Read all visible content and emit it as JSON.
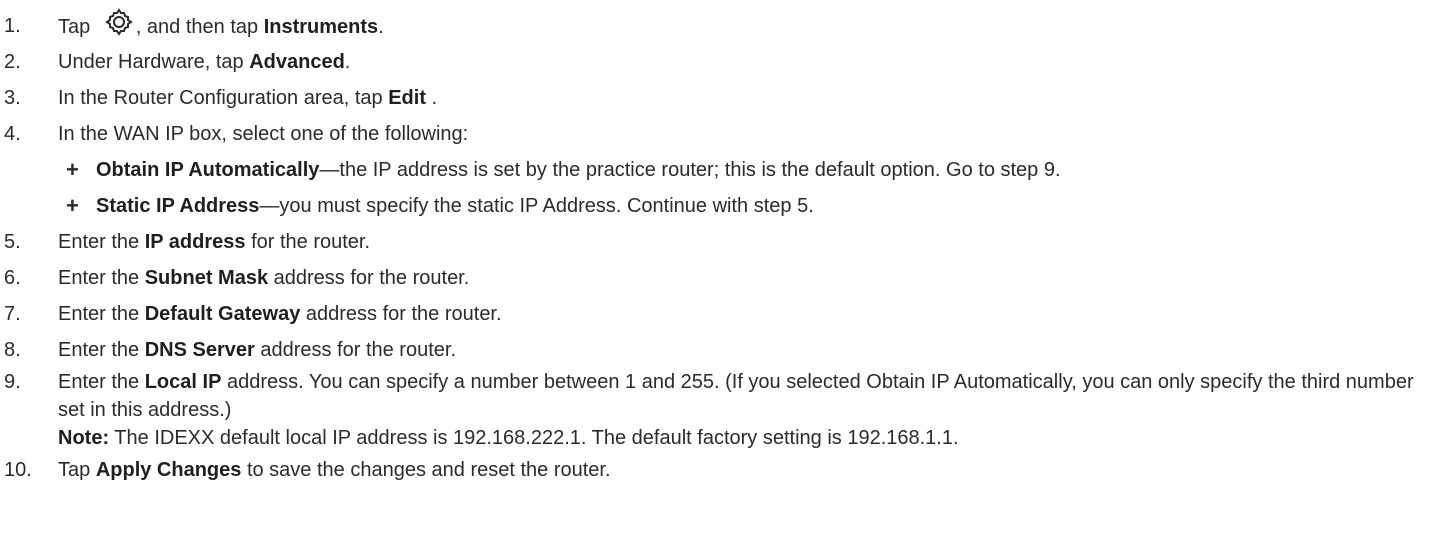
{
  "steps": [
    {
      "num": "1.",
      "pre": "Tap ",
      "mid": ", and then tap ",
      "bold": "Instruments",
      "post": "."
    },
    {
      "num": "2.",
      "pre": "Under Hardware, tap ",
      "bold": "Advanced",
      "post": "."
    },
    {
      "num": "3.",
      "pre": "In the Router Configuration area, tap ",
      "bold": "Edit",
      "post": " ."
    },
    {
      "num": "4.",
      "text": "In the WAN IP box, select one of the following:"
    },
    {
      "num": "5.",
      "pre": "Enter the ",
      "bold": "IP address",
      "post": " for the router."
    },
    {
      "num": "6.",
      "pre": "Enter the ",
      "bold": "Subnet Mask",
      "post": " address for the router."
    },
    {
      "num": "7.",
      "pre": "Enter the ",
      "bold": "Default Gateway",
      "post": " address for the router."
    },
    {
      "num": "8.",
      "pre": "Enter the ",
      "bold": "DNS Server",
      "post": " address for the router."
    },
    {
      "num": "9.",
      "pre": "Enter the ",
      "bold": "Local IP",
      "post": " address. You can specify a number between 1 and 255. (If you selected Obtain IP Automatically, you can only specify the third number set in this address.)",
      "note_label": "Note:",
      "note_text": " The IDEXX default local IP address is 192.168.222.1. The default factory setting is 192.168.1.1."
    },
    {
      "num": "10.",
      "pre": "Tap ",
      "bold": "Apply Changes",
      "post": " to save the changes and reset the router."
    }
  ],
  "options": [
    {
      "marker": "+",
      "bold": "Obtain IP Automatically",
      "text": "—the IP address is set by the practice router; this is the default option. Go to step 9."
    },
    {
      "marker": "+",
      "bold": "Static IP Address",
      "text": "—you must specify the static IP Address. Continue with step 5."
    }
  ],
  "icons": {
    "settings": "gear-icon"
  }
}
